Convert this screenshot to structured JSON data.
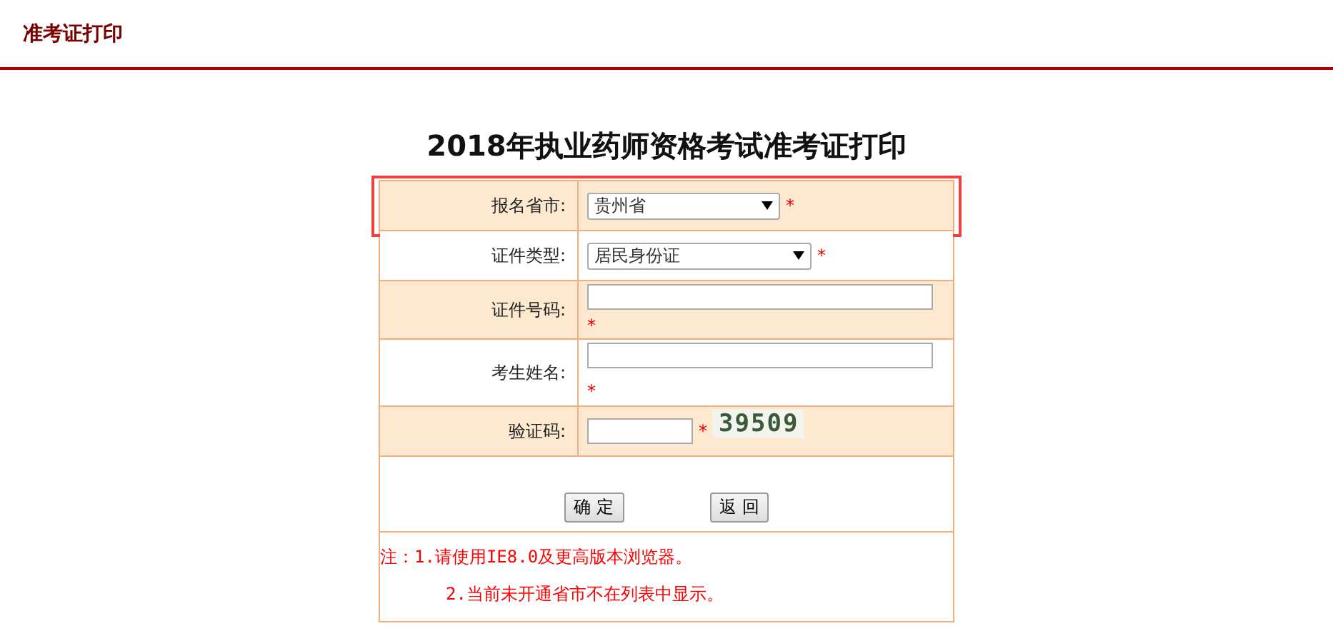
{
  "header": {
    "title": "准考证打印"
  },
  "form": {
    "title": "2018年执业药师资格考试准考证打印",
    "fields": [
      {
        "kind": "select",
        "label": "报名省市:",
        "value": "贵州省",
        "required_mark": "*",
        "highlighted": true,
        "shaded": true
      },
      {
        "kind": "select",
        "label": "证件类型:",
        "value": "居民身份证",
        "required_mark": "*",
        "highlighted": false,
        "shaded": false
      },
      {
        "kind": "text",
        "label": "证件号码:",
        "required_mark": "*",
        "highlighted": false,
        "shaded": true
      },
      {
        "kind": "text_below",
        "label": "考生姓名:",
        "required_mark": "*",
        "highlighted": false,
        "shaded": false
      },
      {
        "kind": "captcha",
        "label": "验证码:",
        "required_mark": "*",
        "captcha": "39509",
        "highlighted": false,
        "shaded": true
      }
    ],
    "buttons": [
      "确 定",
      "返 回"
    ],
    "notes": [
      "注：1.请使用IE8.0及更高版本浏览器。",
      "2.当前未开通省市不在列表中显示。"
    ]
  }
}
